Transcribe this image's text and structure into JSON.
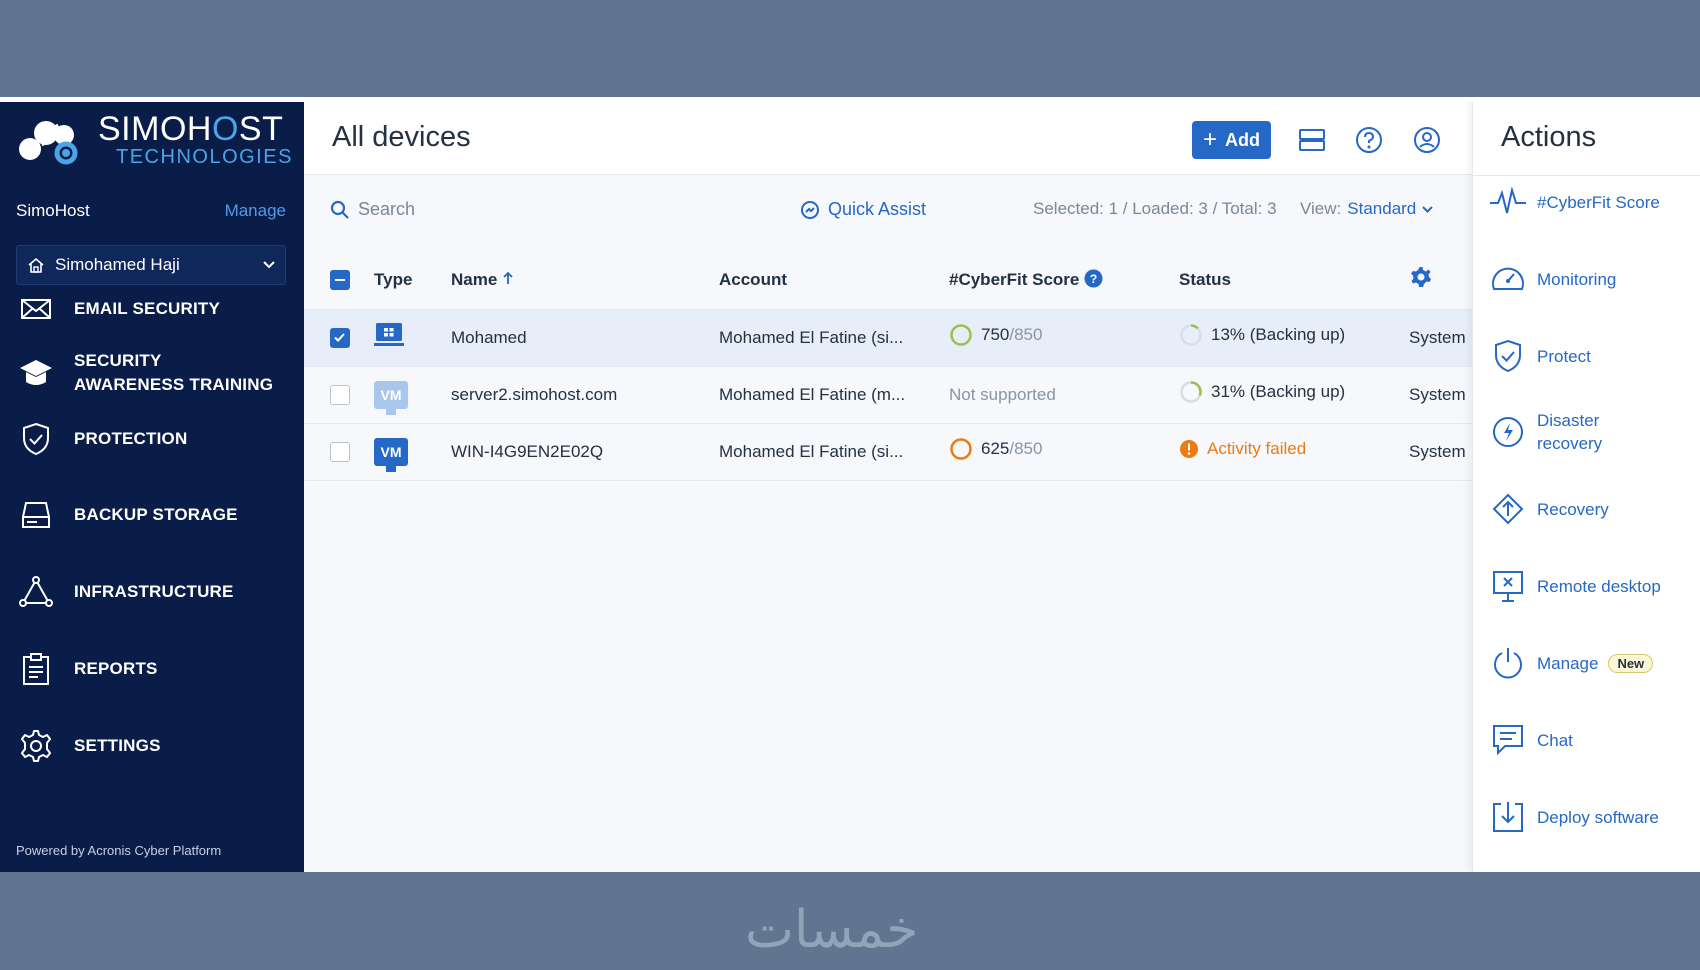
{
  "brand": {
    "name_part1": "SIMOH",
    "name_o": "O",
    "name_part2": "ST",
    "subtitle": "TECHNOLOGIES"
  },
  "tenant": {
    "name": "SimoHost",
    "manage_label": "Manage",
    "selected": "Simohamed Haji"
  },
  "nav": [
    {
      "label": "EMAIL SECURITY",
      "icon": "envelope-icon"
    },
    {
      "label": "SECURITY AWARENESS TRAINING",
      "icon": "graduation-cap-icon"
    },
    {
      "label": "PROTECTION",
      "icon": "shield-check-icon"
    },
    {
      "label": "BACKUP STORAGE",
      "icon": "hard-drive-icon"
    },
    {
      "label": "INFRASTRUCTURE",
      "icon": "network-triangle-icon"
    },
    {
      "label": "REPORTS",
      "icon": "clipboard-report-icon"
    },
    {
      "label": "SETTINGS",
      "icon": "gear-icon"
    }
  ],
  "powered_by": "Powered by Acronis Cyber Platform",
  "header": {
    "title": "All devices",
    "add_label": "Add"
  },
  "toolbar": {
    "search_placeholder": "Search",
    "quick_assist": "Quick Assist",
    "counts": "Selected: 1 / Loaded: 3 / Total: 3",
    "view_label": "View:",
    "view_value": "Standard"
  },
  "table": {
    "columns": {
      "type": "Type",
      "name": "Name",
      "account": "Account",
      "score": "#CyberFit Score",
      "status": "Status"
    },
    "rows": [
      {
        "type": "workstation",
        "name": "Mohamed",
        "account": "Mohamed El Fatine (si...",
        "score": "750",
        "score_max": "/850",
        "status": "13% (Backing up)",
        "progress": 0.13,
        "extra": "System",
        "selected": true
      },
      {
        "type": "VM",
        "name": "server2.simohost.com",
        "account": "Mohamed El Fatine (m...",
        "score_text": "Not supported",
        "status": "31% (Backing up)",
        "progress": 0.31,
        "extra": "System",
        "selected": false
      },
      {
        "type": "VM",
        "name": "WIN-I4G9EN2E02Q",
        "account": "Mohamed El Fatine (si...",
        "score": "625",
        "score_max": "/850",
        "status": "Activity failed",
        "extra": "System",
        "selected": false
      }
    ]
  },
  "actions": {
    "title": "Actions",
    "items": [
      {
        "label": "#CyberFit Score",
        "icon": "pulse-icon"
      },
      {
        "label": "Monitoring",
        "icon": "speedometer-icon"
      },
      {
        "label": "Protect",
        "icon": "shield-check-icon"
      },
      {
        "label": "Disaster recovery",
        "icon": "lightning-circle-icon"
      },
      {
        "label": "Recovery",
        "icon": "recovery-arrows-icon"
      },
      {
        "label": "Remote desktop",
        "icon": "remote-desktop-icon"
      },
      {
        "label": "Manage",
        "icon": "power-icon",
        "badge": "New"
      },
      {
        "label": "Chat",
        "icon": "chat-icon"
      },
      {
        "label": "Deploy software",
        "icon": "deploy-download-icon"
      }
    ]
  },
  "watermark": "خمسات",
  "colors": {
    "sidebar": "#0a1d49",
    "accent": "#2668c5",
    "warning": "#ee7a12",
    "score_good": "#9bc14b",
    "frame": "#607590"
  }
}
